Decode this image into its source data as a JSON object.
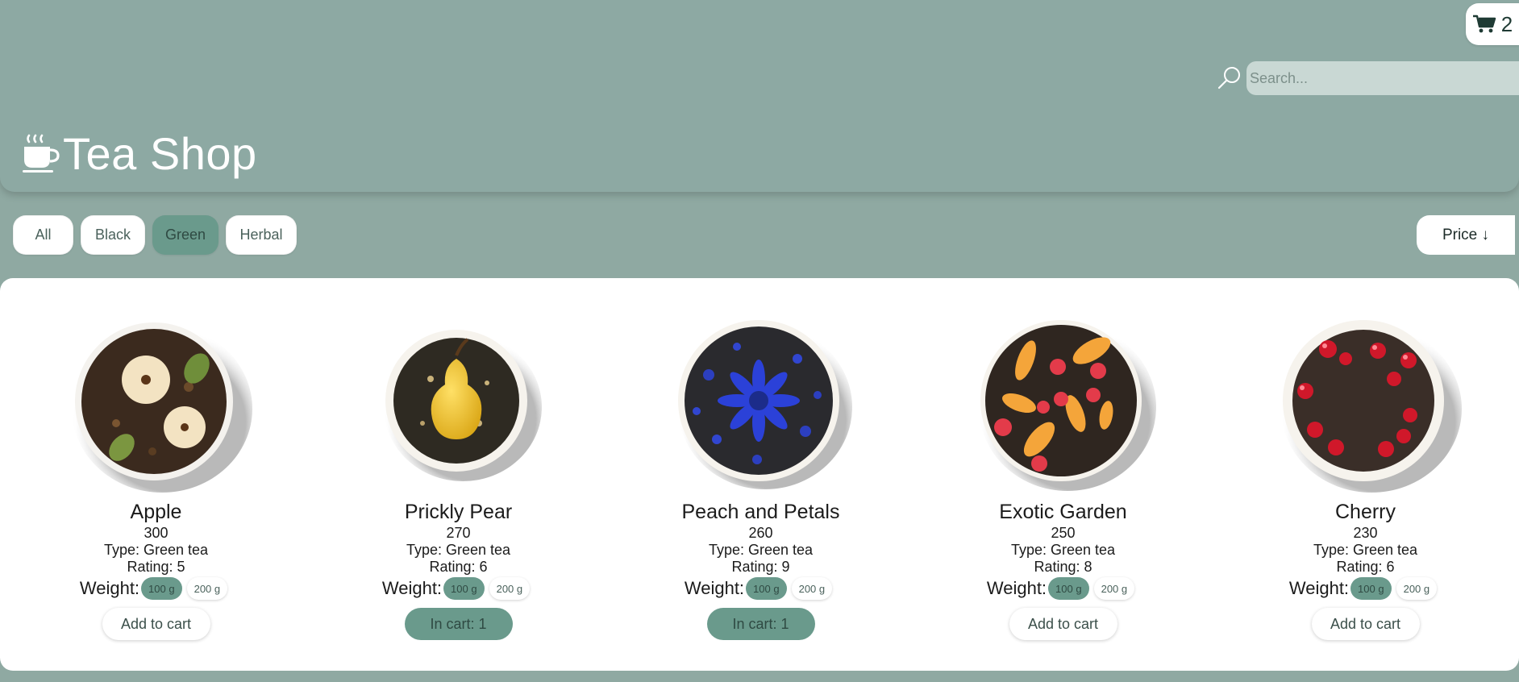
{
  "header": {
    "title": "Tea Shop",
    "cart_count": "2",
    "search_placeholder": "Search..."
  },
  "filters": [
    {
      "label": "All",
      "active": false
    },
    {
      "label": "Black",
      "active": false
    },
    {
      "label": "Green",
      "active": true
    },
    {
      "label": "Herbal",
      "active": false
    }
  ],
  "sort": {
    "label": "Price ↓"
  },
  "products": [
    {
      "name": "Apple",
      "price": "300",
      "type": "Type: Green tea",
      "rating": "Rating: 5",
      "weight_label": "Weight:",
      "weights": [
        "100 g",
        "200 g"
      ],
      "selected_weight": "100 g",
      "action": "Add to cart",
      "in_cart": false,
      "image": "apple-tea-image"
    },
    {
      "name": "Prickly Pear",
      "price": "270",
      "type": "Type: Green tea",
      "rating": "Rating: 6",
      "weight_label": "Weight:",
      "weights": [
        "100 g",
        "200 g"
      ],
      "selected_weight": "100 g",
      "action": "In cart: 1",
      "in_cart": true,
      "image": "pear-tea-image"
    },
    {
      "name": "Peach and Petals",
      "price": "260",
      "type": "Type: Green tea",
      "rating": "Rating: 9",
      "weight_label": "Weight:",
      "weights": [
        "100 g",
        "200 g"
      ],
      "selected_weight": "100 g",
      "action": "In cart: 1",
      "in_cart": true,
      "image": "cornflower-tea-image"
    },
    {
      "name": "Exotic Garden",
      "price": "250",
      "type": "Type: Green tea",
      "rating": "Rating: 8",
      "weight_label": "Weight:",
      "weights": [
        "100 g",
        "200 g"
      ],
      "selected_weight": "100 g",
      "action": "Add to cart",
      "in_cart": false,
      "image": "peach-raspberry-tea-image"
    },
    {
      "name": "Cherry",
      "price": "230",
      "type": "Type: Green tea",
      "rating": "Rating: 6",
      "weight_label": "Weight:",
      "weights": [
        "100 g",
        "200 g"
      ],
      "selected_weight": "100 g",
      "action": "Add to cart",
      "in_cart": false,
      "image": "cherry-tea-image"
    }
  ],
  "colors": {
    "background": "#8fa9a2",
    "accent": "#6a9a8c",
    "panel": "#ffffff",
    "search_bg": "#c9d8d4"
  }
}
